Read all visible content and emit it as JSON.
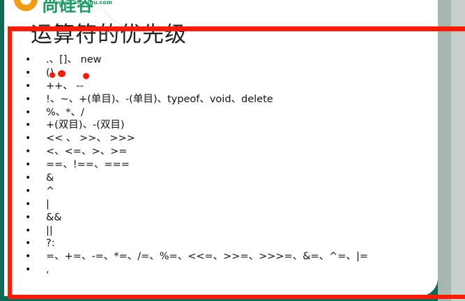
{
  "logo": {
    "text": "尚硅谷",
    "url": "www.atguigu.com"
  },
  "slide": {
    "title": "运算符的优先级"
  },
  "operators": [
    ".、[]、 new",
    "()",
    "++、 --",
    "!、~、+(单目)、-(单目)、typeof、void、delete",
    "%、*、/",
    "+(双目)、-(双目)",
    "<< 、 >>、 >>>",
    "<、<=、>、>=",
    "==、!==、===",
    "&",
    "^",
    "|",
    "&&",
    "||",
    "?:",
    "=、+=、-=、*=、/=、%=、<<=、>>=、>>>=、&=、^=、|=",
    ","
  ],
  "bullet_symbol": "•",
  "colors": {
    "frame_green": "#0c6b55",
    "annotation_red": "#ff1a00",
    "logo_orange": "#f39c12",
    "logo_green": "#1a9a64"
  }
}
